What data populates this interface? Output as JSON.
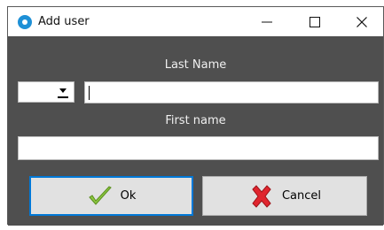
{
  "window": {
    "title": "Add user",
    "controls": {
      "minimize": "minimize",
      "maximize": "maximize",
      "close": "close"
    }
  },
  "form": {
    "last_name_label": "Last Name",
    "first_name_label": "First name",
    "combo": {
      "selected": ""
    },
    "last_name_value": "",
    "first_name_value": ""
  },
  "buttons": {
    "ok_label": "Ok",
    "cancel_label": "Cancel"
  },
  "icons": {
    "app": "add-user-app-icon",
    "ok": "checkmark-icon",
    "cancel": "red-x-icon",
    "combo_arrow": "dropdown-arrow-icon"
  },
  "colors": {
    "dialog_background": "#4f4f4f",
    "title_bar": "#ffffff",
    "focus_border": "#0078d7",
    "app_icon": "#1e90d6",
    "check_green": "#8cc63f",
    "cancel_red": "#e0252e"
  }
}
